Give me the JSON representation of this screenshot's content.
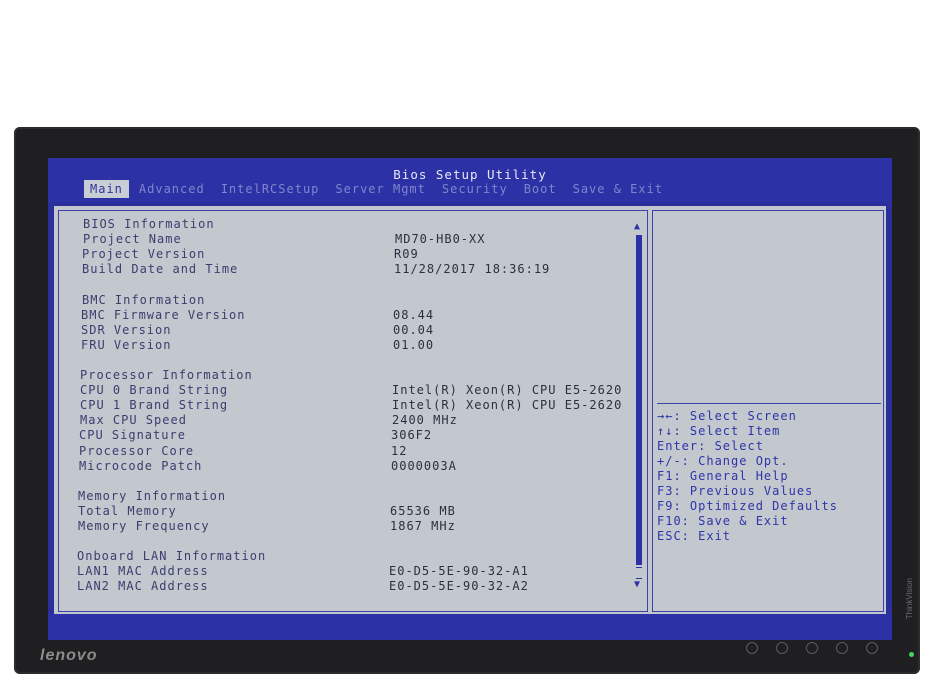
{
  "bios": {
    "title": "Bios Setup Utility",
    "tabs": [
      "Main",
      "Advanced",
      "IntelRCSetup",
      "Server Mgmt",
      "Security",
      "Boot",
      "Save & Exit"
    ],
    "active_tab": "Main",
    "rows": [
      {
        "label": "BIOS Information",
        "value": "",
        "section": true
      },
      {
        "label": "Project Name",
        "value": "MD70-HB0-XX"
      },
      {
        "label": "Project Version",
        "value": "R09"
      },
      {
        "label": "Build Date and Time",
        "value": "11/28/2017 18:36:19"
      },
      {
        "label": "",
        "value": ""
      },
      {
        "label": "BMC Information",
        "value": "",
        "section": true
      },
      {
        "label": "BMC Firmware Version",
        "value": "08.44"
      },
      {
        "label": "SDR Version",
        "value": "00.04"
      },
      {
        "label": "FRU Version",
        "value": "01.00"
      },
      {
        "label": "",
        "value": ""
      },
      {
        "label": "Processor Information",
        "value": "",
        "section": true
      },
      {
        "label": "CPU 0 Brand String",
        "value": "Intel(R) Xeon(R) CPU E5-2620"
      },
      {
        "label": "CPU 1 Brand String",
        "value": "Intel(R) Xeon(R) CPU E5-2620"
      },
      {
        "label": "Max CPU Speed",
        "value": "2400 MHz"
      },
      {
        "label": "CPU Signature",
        "value": "306F2"
      },
      {
        "label": "Processor Core",
        "value": "12"
      },
      {
        "label": "Microcode Patch",
        "value": "0000003A"
      },
      {
        "label": "",
        "value": ""
      },
      {
        "label": "Memory Information",
        "value": "",
        "section": true
      },
      {
        "label": "Total Memory",
        "value": "65536 MB"
      },
      {
        "label": "Memory Frequency",
        "value": "1867 MHz"
      },
      {
        "label": "",
        "value": ""
      },
      {
        "label": "Onboard LAN Information",
        "value": "",
        "section": true
      },
      {
        "label": "LAN1 MAC Address",
        "value": "E0-D5-5E-90-32-A1"
      },
      {
        "label": "LAN2 MAC Address",
        "value": "E0-D5-5E-90-32-A2"
      }
    ],
    "help": [
      "→←: Select Screen",
      "↑↓: Select Item",
      "Enter: Select",
      "+/-: Change Opt.",
      "F1: General Help",
      "F3: Previous Values",
      "F9: Optimized Defaults",
      "F10: Save & Exit",
      "ESC: Exit"
    ]
  },
  "monitor": {
    "brand": "lenovo",
    "side_label": "ThinkVision"
  },
  "colors": {
    "bios_blue": "#2c31a6",
    "panel_grey": "#c3c8cf"
  }
}
